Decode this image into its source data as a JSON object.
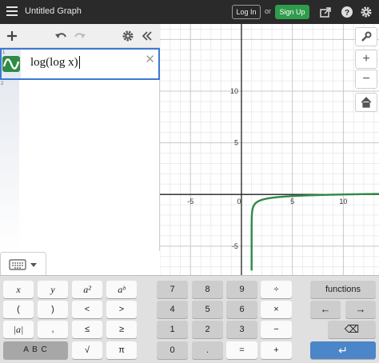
{
  "header": {
    "title": "Untitled Graph",
    "login_label": "Log In",
    "or_label": "or",
    "signup_label": "Sign Up",
    "icons": [
      "hamburger-icon",
      "share-icon",
      "help-icon",
      "gear-icon"
    ]
  },
  "expression_list": {
    "toolbar_icons": [
      "add-icon",
      "undo-icon",
      "redo-icon",
      "gear-icon",
      "collapse-icon"
    ],
    "expressions": [
      {
        "number": "1",
        "latex": "log(log x)",
        "display": "log(log x)",
        "color": "#2f8a45"
      }
    ],
    "next_row_number": "2"
  },
  "graph": {
    "x_tick_labels": [
      "-5",
      "0",
      "5",
      "10"
    ],
    "y_tick_labels": [
      "10",
      "5",
      "-5"
    ],
    "x_range": [
      -8.0,
      13.5
    ],
    "y_range": [
      -7.8,
      16.5
    ],
    "grid": true,
    "curve_color": "#2f8a45",
    "side_buttons": [
      "wrench-icon",
      "zoom-in-icon",
      "zoom-out-icon",
      "home-icon"
    ],
    "side_labels": [
      "+",
      "−"
    ]
  },
  "keypad": {
    "left": {
      "row1": [
        "x",
        "y",
        "a²",
        "aᵇ"
      ],
      "row2": [
        "(",
        ")",
        "<",
        ">"
      ],
      "row3": [
        "|a|",
        ",",
        "≤",
        "≥"
      ],
      "row4": [
        "A B C",
        "√",
        "π"
      ]
    },
    "middle": {
      "row1": [
        "7",
        "8",
        "9",
        "÷"
      ],
      "row2": [
        "4",
        "5",
        "6",
        "×"
      ],
      "row3": [
        "1",
        "2",
        "3",
        "−"
      ],
      "row4": [
        "0",
        ".",
        "=",
        "+"
      ]
    },
    "right": {
      "functions_label": "functions",
      "left_arrow": "←",
      "right_arrow": "→",
      "backspace": "⌫",
      "enter": "↵"
    }
  }
}
